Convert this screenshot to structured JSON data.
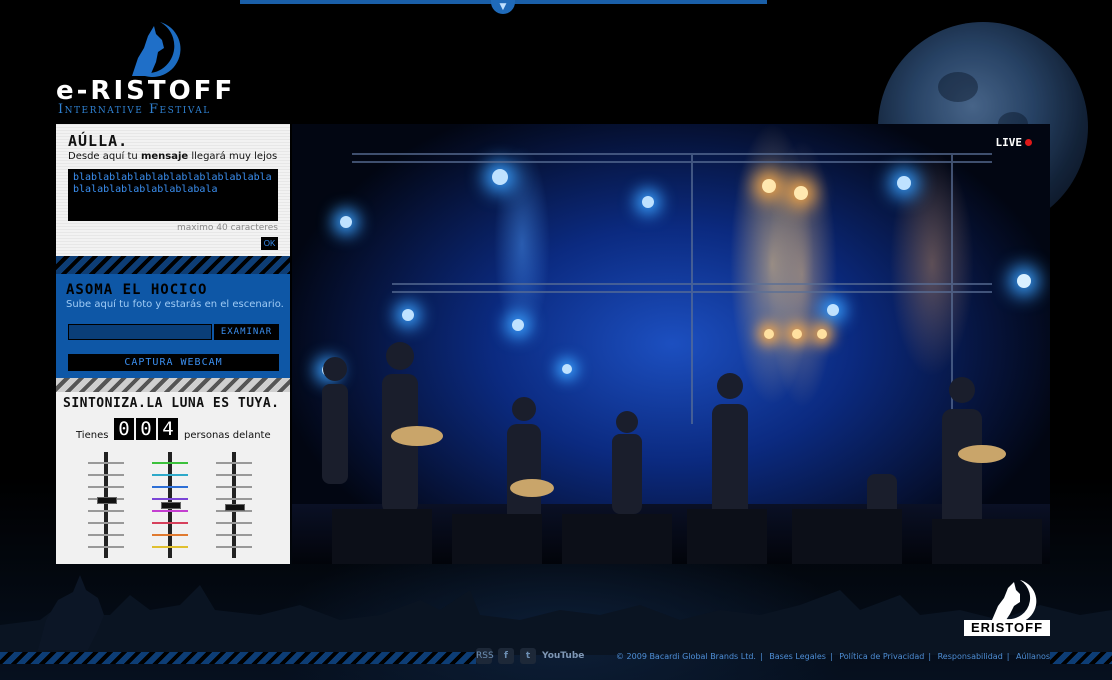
{
  "brand": {
    "logo_text": "e-RISTOFF",
    "logo_subtitle": "Internative Festival",
    "footer_logo_text": "ERISTOFF"
  },
  "aulla": {
    "title": "AÚLLA.",
    "desc_pre": "Desde aquí tu ",
    "desc_bold": "mensaje",
    "desc_post": " llegará muy lejos",
    "message_value": "blablablablablablablablablablablablalablablablablablabala",
    "max_chars": "maximo 40 caracteres",
    "ok_label": "OK"
  },
  "asoma": {
    "title": "ASOMA EL HOCICO",
    "desc": "Sube aquí tu foto y estarás en el escenario.",
    "browse_label": "EXAMINAR",
    "webcam_label": "CAPTURA WEBCAM"
  },
  "sintoniza": {
    "title_a": "SINTONIZA.",
    "title_b": "LA LUNA ES TUYA.",
    "pre": "Tienes",
    "digits": [
      "0",
      "0",
      "4"
    ],
    "post": "personas delante"
  },
  "stage": {
    "live_label": "LIVE"
  },
  "footer": {
    "social": {
      "rss": "RSS",
      "facebook": "f",
      "twitter": "t",
      "youtube": "YouTube"
    },
    "copyright": "© 2009 Bacardi Global Brands Ltd.",
    "links": [
      "Bases Legales",
      "Política de Privacidad",
      "Responsabilidad",
      "Aúllanos"
    ]
  },
  "colors": {
    "accent_blue": "#0e57a6",
    "link_blue": "#3b8ff0",
    "live_red": "#e01818"
  }
}
